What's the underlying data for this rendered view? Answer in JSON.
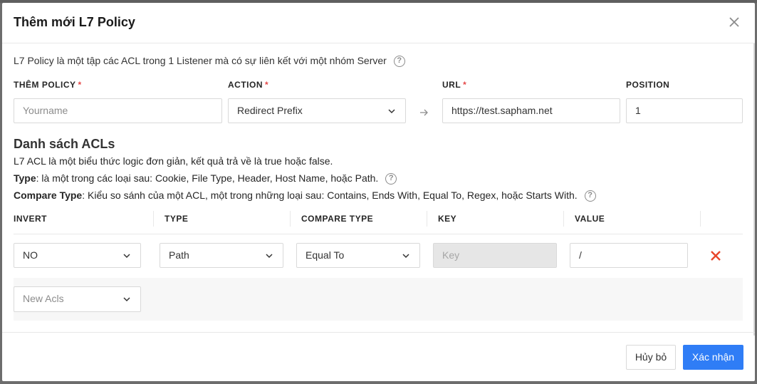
{
  "modal": {
    "title": "Thêm mới L7 Policy",
    "description": "L7 Policy là một tập các ACL trong 1 Listener mà có sự liên kết với một nhóm Server"
  },
  "form": {
    "policy": {
      "label": "THÊM POLICY",
      "required_mark": "*",
      "placeholder": "Yourname",
      "value": ""
    },
    "action": {
      "label": "ACTION",
      "required_mark": "*",
      "value": "Redirect Prefix"
    },
    "url": {
      "label": "URL",
      "required_mark": "*",
      "value": "https://test.sapham.net"
    },
    "position": {
      "label": "POSITION",
      "value": "1"
    }
  },
  "acls": {
    "title": "Danh sách ACLs",
    "intro": "L7 ACL là một biểu thức logic đơn giản, kết quả trả về là true hoặc false.",
    "type_term": "Type",
    "type_desc": ": là một trong các loại sau: Cookie, File Type, Header, Host Name, hoặc Path.",
    "compare_term": "Compare Type",
    "compare_desc": ": Kiểu so sánh của một ACL, một trong những loại sau: Contains, Ends With, Equal To, Regex, hoặc Starts With.",
    "columns": [
      "INVERT",
      "TYPE",
      "COMPARE TYPE",
      "KEY",
      "VALUE"
    ],
    "row": {
      "invert": "NO",
      "type": "Path",
      "compare_type": "Equal To",
      "key_placeholder": "Key",
      "value": "/"
    },
    "new_placeholder": "New Acls"
  },
  "footer": {
    "cancel_label": "Hủy bỏ",
    "confirm_label": "Xác nhận"
  },
  "colors": {
    "primary": "#2f7df6",
    "danger": "#e8462a",
    "required": "#e54848"
  },
  "icons": [
    "close-icon",
    "help-icon",
    "chevron-down-icon",
    "arrow-right-icon",
    "delete-icon"
  ]
}
